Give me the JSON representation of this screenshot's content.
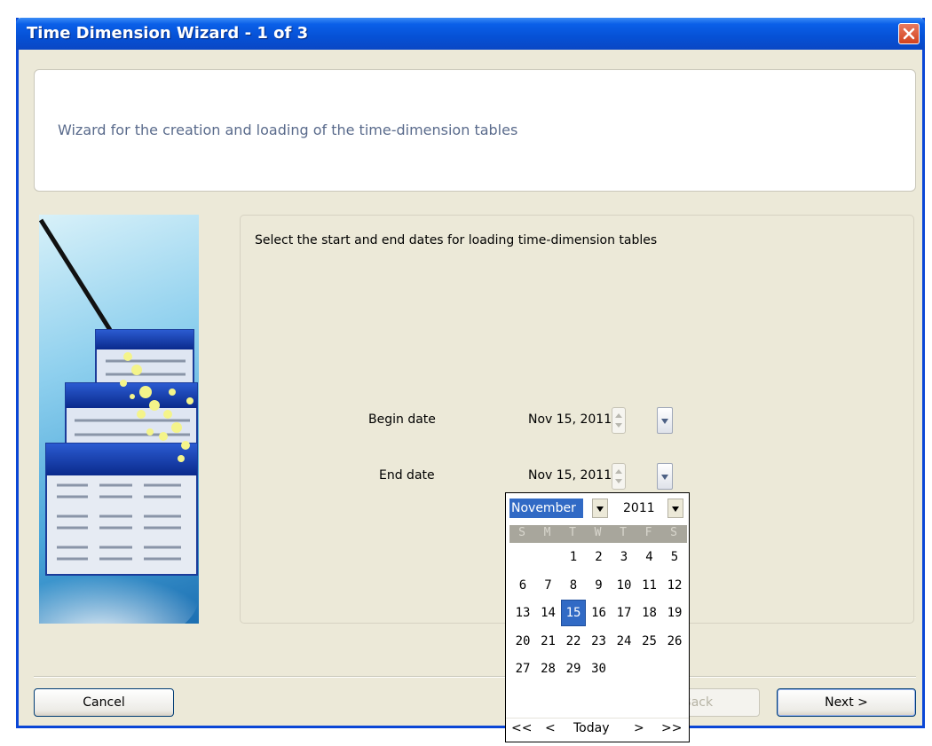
{
  "window": {
    "title": "Time Dimension Wizard - 1 of 3",
    "close_icon": "close-icon",
    "accent_color": "#0a5fe8"
  },
  "header": {
    "text": "Wizard for the creation and loading of the time-dimension tables"
  },
  "content": {
    "instruction": "Select the start and end dates for loading time-dimension tables",
    "begin_date": {
      "label": "Begin date",
      "value": "Nov 15, 2011"
    },
    "end_date": {
      "label": "End date",
      "value": "Nov 15, 2011"
    }
  },
  "calendar": {
    "month": "November",
    "year": "2011",
    "weekdays": [
      "S",
      "M",
      "T",
      "W",
      "T",
      "F",
      "S"
    ],
    "weeks": [
      [
        "",
        "",
        "1",
        "2",
        "3",
        "4",
        "5"
      ],
      [
        "6",
        "7",
        "8",
        "9",
        "10",
        "11",
        "12"
      ],
      [
        "13",
        "14",
        "15",
        "16",
        "17",
        "18",
        "19"
      ],
      [
        "20",
        "21",
        "22",
        "23",
        "24",
        "25",
        "26"
      ],
      [
        "27",
        "28",
        "29",
        "30",
        "",
        "",
        ""
      ]
    ],
    "selected_day": "15",
    "nav": {
      "first": "<<",
      "prev": "<",
      "today": "Today",
      "next": ">",
      "last": ">>"
    },
    "selected_color": "#316ac5"
  },
  "buttons": {
    "cancel": "Cancel",
    "back": "< Back",
    "next": "Next >"
  }
}
